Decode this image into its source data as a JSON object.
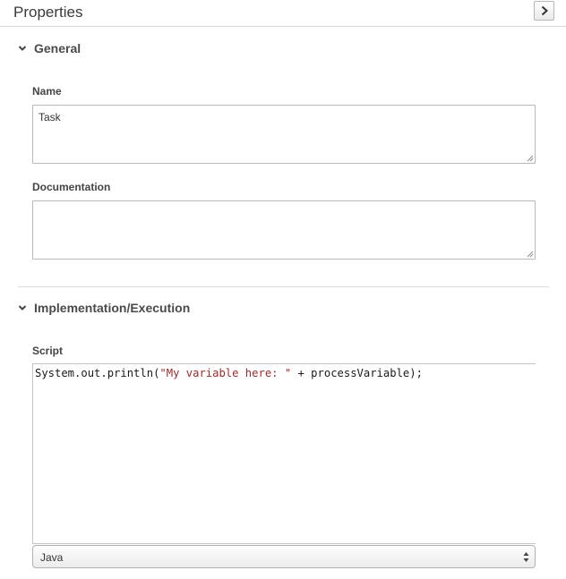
{
  "header": {
    "title": "Properties",
    "collapse_icon": "chevron-right-icon"
  },
  "sections": {
    "general": {
      "title": "General",
      "icon": "chevron-down-icon"
    },
    "implementation": {
      "title": "Implementation/Execution",
      "icon": "chevron-down-icon"
    }
  },
  "fields": {
    "name": {
      "label": "Name",
      "value": "Task"
    },
    "documentation": {
      "label": "Documentation",
      "value": ""
    },
    "script": {
      "label": "Script",
      "code": {
        "prefix": "System.out.println(",
        "string": "\"My variable here: \"",
        "suffix": " + processVariable);"
      }
    },
    "language": {
      "selected": "Java"
    }
  },
  "colors": {
    "string_literal": "#9c2b2b",
    "divider": "#dcdcdc"
  }
}
